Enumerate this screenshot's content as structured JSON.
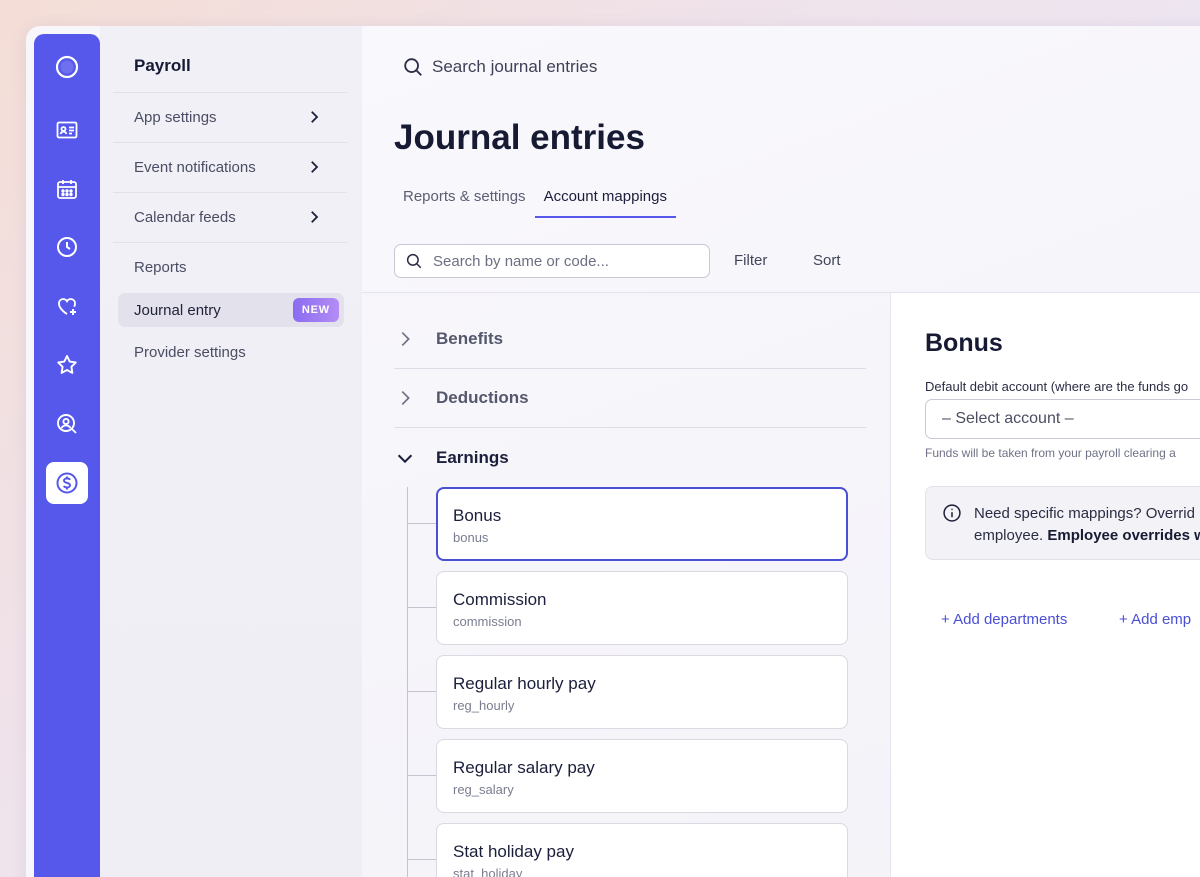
{
  "rail": {
    "icons": [
      "logo-icon",
      "id-card-icon",
      "calendar-icon",
      "clock-icon",
      "heart-plus-icon",
      "star-icon",
      "user-search-icon",
      "dollar-icon"
    ],
    "active": "dollar-icon",
    "color": "#5558ea"
  },
  "nav": {
    "title": "Payroll",
    "items": [
      {
        "label": "App settings"
      },
      {
        "label": "Event notifications"
      },
      {
        "label": "Calendar feeds"
      },
      {
        "label": "Reports"
      },
      {
        "label": "Journal entry",
        "badge": "NEW"
      },
      {
        "label": "Provider settings"
      }
    ],
    "active_item": "Journal entry"
  },
  "header": {
    "search_label": "Search journal entries",
    "title": "Journal entries",
    "tabs": [
      {
        "label": "Reports & settings"
      },
      {
        "label": "Account mappings"
      }
    ],
    "active_tab": "Account mappings"
  },
  "toolbar": {
    "search_placeholder": "Search by name or code...",
    "filter_label": "Filter",
    "sort_label": "Sort"
  },
  "categories": [
    {
      "label": "Benefits",
      "expanded": false
    },
    {
      "label": "Deductions",
      "expanded": false
    },
    {
      "label": "Earnings",
      "expanded": true
    }
  ],
  "earnings": [
    {
      "name": "Bonus",
      "code": "bonus"
    },
    {
      "name": "Commission",
      "code": "commission"
    },
    {
      "name": "Regular hourly pay",
      "code": "reg_hourly"
    },
    {
      "name": "Regular salary pay",
      "code": "reg_salary"
    },
    {
      "name": "Stat holiday pay",
      "code": "stat_holiday"
    }
  ],
  "selected_earning": "Bonus",
  "detail": {
    "title": "Bonus",
    "field_label": "Default debit account (where are the funds go",
    "select_value": "– Select account –",
    "helper": "Funds will be taken from your payroll clearing a",
    "info_line1": "Need specific mappings? Overrid",
    "info_line2_plain": "employee. ",
    "info_line2_bold": "Employee overrides w",
    "add_departments": "+ Add departments",
    "add_employees": "+ Add emp"
  },
  "colors": {
    "accent": "#5558ea",
    "selected_border": "#4a4fd4",
    "badge_gradient_start": "#8b6cf2"
  }
}
